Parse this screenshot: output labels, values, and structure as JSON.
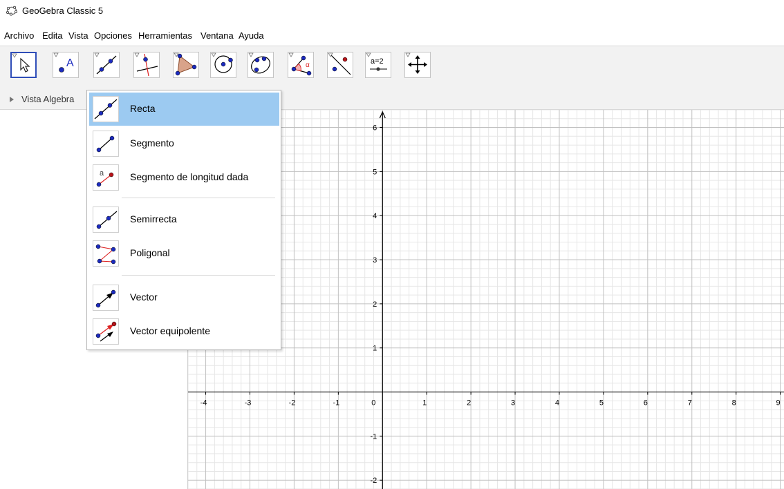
{
  "window": {
    "title": "GeoGebra Classic 5",
    "icon": "geogebra-logo-icon"
  },
  "menu": [
    "Archivo",
    "Edita",
    "Vista",
    "Opciones",
    "Herramientas",
    "Ventana",
    "Ayuda"
  ],
  "toolbar": {
    "tools": [
      {
        "name": "move-tool",
        "icon": "arrow-pointer-icon",
        "selected": true
      },
      {
        "name": "point-tool",
        "icon": "point-a-icon",
        "label": "A"
      },
      {
        "name": "line-tool",
        "icon": "line-through-points-icon"
      },
      {
        "name": "perpendicular-tool",
        "icon": "perpendicular-line-icon"
      },
      {
        "name": "polygon-tool",
        "icon": "polygon-icon"
      },
      {
        "name": "circle-tool",
        "icon": "circle-center-point-icon"
      },
      {
        "name": "conic-tool",
        "icon": "ellipse-icon"
      },
      {
        "name": "angle-tool",
        "icon": "angle-icon",
        "label": "α"
      },
      {
        "name": "reflect-tool",
        "icon": "reflect-line-icon"
      },
      {
        "name": "slider-tool",
        "icon": "slider-icon",
        "label": "a=2"
      },
      {
        "name": "move-view-tool",
        "icon": "move-graphics-view-icon"
      }
    ]
  },
  "algebra_panel": {
    "label": "Vista Algebra"
  },
  "line_tools_menu": {
    "items": [
      {
        "label": "Recta",
        "icon": "line-icon",
        "active": true
      },
      {
        "label": "Segmento",
        "icon": "segment-icon"
      },
      {
        "label": "Segmento de longitud dada",
        "icon": "segment-given-length-icon",
        "icon_letter": "a"
      },
      {
        "label": "Semirrecta",
        "icon": "ray-icon"
      },
      {
        "label": "Poligonal",
        "icon": "polyline-icon"
      },
      {
        "label": "Vector",
        "icon": "vector-icon"
      },
      {
        "label": "Vector equipolente",
        "icon": "vector-from-point-icon"
      }
    ]
  },
  "graphics_view": {
    "x_ticks": [
      "-4",
      "-3",
      "-2",
      "-1",
      "0",
      "1",
      "2",
      "3",
      "4",
      "5",
      "6",
      "7",
      "8",
      "9"
    ],
    "y_ticks": [
      "6",
      "5",
      "4",
      "3",
      "2",
      "1",
      "-1",
      "-2"
    ],
    "x_range": [
      -4.4,
      9.1
    ],
    "y_range": [
      -2.2,
      6.4
    ],
    "grid": true,
    "colors": {
      "major_grid": "#c0c0c0",
      "minor_grid": "#e6e6e6",
      "axis": "#000000",
      "point": "#1c2bbf",
      "highlight": "#9ccaf1",
      "selected_border": "#2f4db8"
    }
  }
}
